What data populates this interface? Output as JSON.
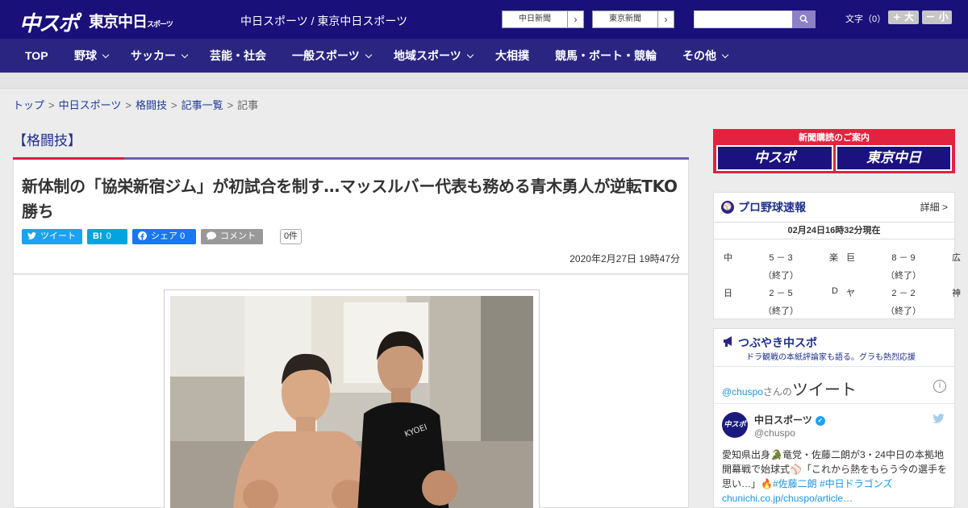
{
  "header": {
    "logo_main": "中スポ",
    "logo_sub": "東京中日",
    "logo_sub_small": "スポーツ",
    "site_name": "中日スポーツ / 東京中日スポーツ",
    "ext_links": [
      {
        "label": "中日新聞",
        "arrow": "›"
      },
      {
        "label": "東京新聞",
        "arrow": "›"
      }
    ],
    "search_placeholder": "",
    "font_size_label": "文字（0）",
    "font_plus": "+ 大",
    "font_minus": "－ 小"
  },
  "nav": {
    "items": [
      {
        "label": "TOP",
        "dropdown": false
      },
      {
        "label": "野球",
        "dropdown": true
      },
      {
        "label": "サッカー",
        "dropdown": true
      },
      {
        "label": "芸能・社会",
        "dropdown": false
      },
      {
        "label": "一般スポーツ",
        "dropdown": true
      },
      {
        "label": "地域スポーツ",
        "dropdown": true
      },
      {
        "label": "大相撲",
        "dropdown": false
      },
      {
        "label": "競馬・ボート・競輪",
        "dropdown": false
      },
      {
        "label": "その他",
        "dropdown": true
      }
    ]
  },
  "breadcrumb": {
    "items": [
      "トップ",
      "中日スポーツ",
      "格闘技",
      "記事一覧"
    ],
    "current": "記事",
    "separator": ">"
  },
  "article": {
    "category": "【格闘技】",
    "headline": "新体制の「協栄新宿ジム」が初試合を制す…マッスルバー代表も務める青木勇人が逆転TKO勝ち",
    "share": {
      "tweet": "ツイート",
      "hatena_icon": "B!",
      "hatena_count": "0",
      "facebook": "シェア",
      "facebook_count": "0",
      "comment": "コメント",
      "comment_count": "0件"
    },
    "date": "2020年2月27日 19時47分"
  },
  "sidebar": {
    "subscribe": {
      "title": "新聞購読のご案内",
      "logo1": "中スポ",
      "logo2": "東京中日"
    },
    "baseball": {
      "title": "プロ野球速報",
      "more": "詳細 >",
      "updated": "02月24日16時32分現在",
      "games": [
        {
          "home": "中",
          "score": "5 － 3",
          "away": "楽",
          "status": "（終了）"
        },
        {
          "home": "巨",
          "score": "8 － 9",
          "away": "広",
          "status": "（終了）"
        },
        {
          "home": "日",
          "score": "2 － 5",
          "away": "D",
          "status": "（終了）"
        },
        {
          "home": "ヤ",
          "score": "2 － 2",
          "away": "神",
          "status": "（終了）"
        }
      ]
    },
    "tweets": {
      "title": "つぶやき中スポ",
      "subtitle": "ドラ観戦の本紙評論家も語る。グラも熱烈応援",
      "handle_link": "@chuspo",
      "handle_suffix": "さんの",
      "tweet_word": "ツイート",
      "info_icon": "i",
      "account_name": "中日スポーツ",
      "account_handle": "@chuspo",
      "avatar_text": "中スポ",
      "body": "愛知県出身🐊竜党・佐藤二朗が3・24中日の本拠地開幕戦で始球式⚾「これから熱をもらう今の選手を思い…」🔥",
      "tags": "#佐藤二朗 #中日ドラゴンズ",
      "link": "chunichi.co.jp/chuspo/article…"
    }
  }
}
